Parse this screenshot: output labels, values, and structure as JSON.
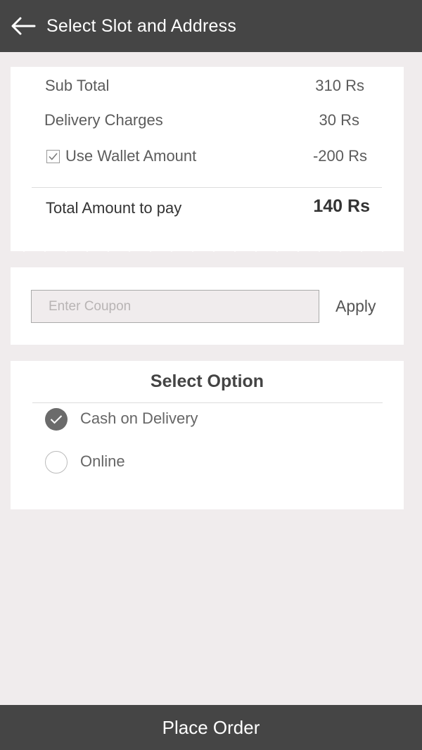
{
  "header": {
    "back_icon": "arrow-left-icon",
    "title": "Select Slot and Address"
  },
  "bill": {
    "sub_total_label": "Sub Total",
    "sub_total_value": "310 Rs",
    "delivery_label": "Delivery Charges",
    "delivery_value": "30 Rs",
    "wallet_label": "Use Wallet Amount",
    "wallet_value": "-200 Rs",
    "wallet_checked": true,
    "total_label": "Total Amount to pay",
    "total_value": "140 Rs"
  },
  "coupon": {
    "placeholder": "Enter Coupon",
    "value": "",
    "apply_label": "Apply"
  },
  "payment": {
    "title": "Select Option",
    "options": [
      {
        "label": "Cash on Delivery",
        "selected": true
      },
      {
        "label": "Online",
        "selected": false
      }
    ]
  },
  "footer": {
    "place_order_label": "Place Order"
  },
  "colors": {
    "bar": "#454545",
    "background": "#f0eced",
    "card": "#ffffff",
    "radio_selected": "#6b6b6b"
  }
}
